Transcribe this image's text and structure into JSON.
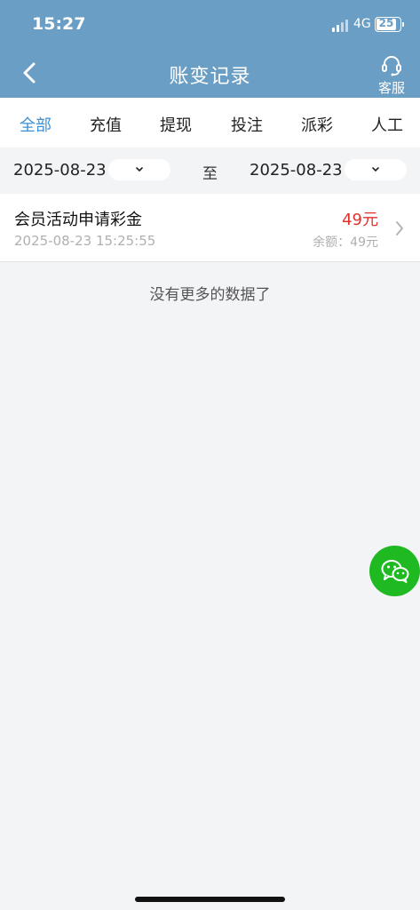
{
  "status_bar": {
    "time": "15:27",
    "network": "4G",
    "battery": "25"
  },
  "nav": {
    "title": "账变记录",
    "service_label": "客服"
  },
  "tabs": [
    {
      "label": "全部",
      "active": true
    },
    {
      "label": "充值",
      "active": false
    },
    {
      "label": "提现",
      "active": false
    },
    {
      "label": "投注",
      "active": false
    },
    {
      "label": "派彩",
      "active": false
    },
    {
      "label": "人工",
      "active": false
    }
  ],
  "date_filter": {
    "start": "2025-08-23",
    "separator": "至",
    "end": "2025-08-23"
  },
  "records": [
    {
      "title": "会员活动申请彩金",
      "time": "2025-08-23 15:25:55",
      "amount": "49元",
      "balance": "余额：49元"
    }
  ],
  "empty_text": "没有更多的数据了",
  "colors": {
    "header": "#6a9ec5",
    "active_tab": "#3d8fd6",
    "amount": "#e0322b",
    "wechat": "#1fb922"
  },
  "icons": {
    "back": "chevron-left-icon",
    "service": "headset-icon",
    "dropdown": "chevron-down-icon",
    "row": "chevron-right-icon",
    "float": "wechat-icon"
  }
}
